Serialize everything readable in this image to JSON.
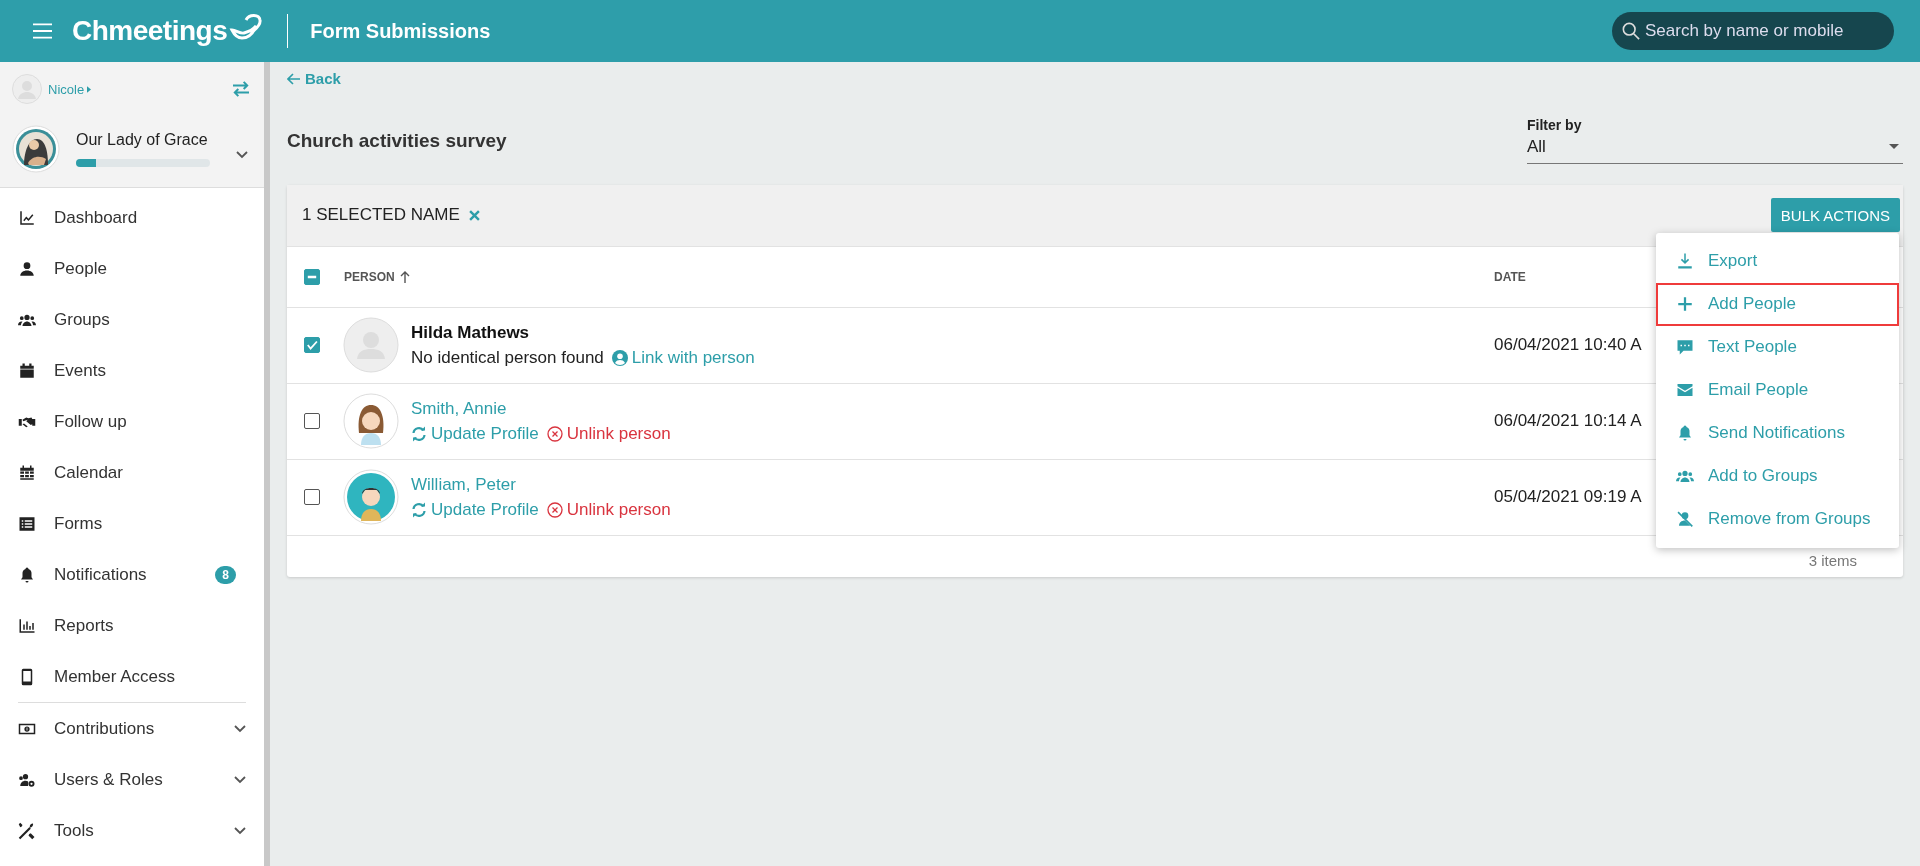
{
  "header": {
    "logo": "Chmeetings",
    "title": "Form Submissions",
    "search": {
      "placeholder": "Search by name or mobile"
    }
  },
  "sidebar": {
    "user": {
      "name": "Nicole"
    },
    "organization": {
      "name": "Our Lady of Grace",
      "level": 0.15
    },
    "items": [
      {
        "label": "Dashboard"
      },
      {
        "label": "People"
      },
      {
        "label": "Groups"
      },
      {
        "label": "Events"
      },
      {
        "label": "Follow up"
      },
      {
        "label": "Calendar"
      },
      {
        "label": "Forms"
      },
      {
        "label": "Notifications",
        "badge": "8"
      },
      {
        "label": "Reports"
      },
      {
        "label": "Member Access"
      }
    ],
    "sections": [
      {
        "label": "Contributions",
        "expanded": false
      },
      {
        "label": "Users & Roles",
        "expanded": false
      },
      {
        "label": "Tools",
        "expanded": false
      }
    ]
  },
  "main": {
    "back": "Back",
    "title": "Church activities survey",
    "filter": {
      "label": "Filter by",
      "value": "All"
    },
    "table": {
      "selection_label": "1 SELECTED NAME",
      "bulk_button": "BULK ACTIONS",
      "select_all_partial": true,
      "columns": [
        "PERSON",
        "DATE"
      ],
      "rows": [
        {
          "name": "Hilda Mathews",
          "linked": false,
          "note": "No identical person found",
          "actions": [
            {
              "kind": "link",
              "label": "Link with person"
            }
          ],
          "date": "06/04/2021 10:40 A",
          "selected": true
        },
        {
          "name": "Smith, Annie",
          "linked": true,
          "actions": [
            {
              "kind": "update",
              "label": "Update Profile"
            },
            {
              "kind": "unlink",
              "label": "Unlink person"
            }
          ],
          "date": "06/04/2021 10:14 A",
          "selected": false
        },
        {
          "name": "William, Peter",
          "linked": true,
          "actions": [
            {
              "kind": "update",
              "label": "Update Profile"
            },
            {
              "kind": "unlink",
              "label": "Unlink person"
            }
          ],
          "date": "05/04/2021 09:19 A",
          "selected": false
        }
      ],
      "footer": "3 items"
    },
    "menu": {
      "items": [
        {
          "label": "Export",
          "selected": false
        },
        {
          "label": "Add People",
          "selected": true
        },
        {
          "label": "Text People",
          "selected": false
        },
        {
          "label": "Email People",
          "selected": false
        },
        {
          "label": "Send Notifications",
          "selected": false
        },
        {
          "label": "Add to Groups",
          "selected": false
        },
        {
          "label": "Remove from Groups",
          "selected": false
        }
      ]
    }
  }
}
